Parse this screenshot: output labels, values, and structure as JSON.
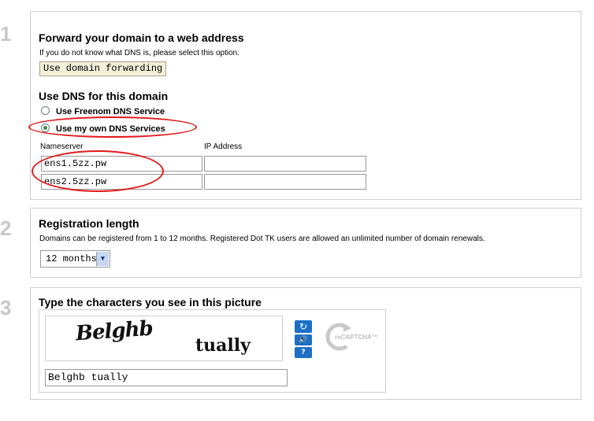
{
  "steps": {
    "one": "1",
    "two": "2",
    "three": "3"
  },
  "forwarding": {
    "title": "Forward your domain to a web address",
    "hint": "If you do not know what DNS is, please select this option.",
    "button_label": "Use domain forwarding"
  },
  "dns": {
    "title": "Use DNS for this domain",
    "options": [
      {
        "label": "Use Freenom DNS Service",
        "selected": false
      },
      {
        "label": "Use my own DNS Services",
        "selected": true
      }
    ],
    "col_nameserver": "Nameserver",
    "col_ip": "IP Address",
    "rows": [
      {
        "nameserver": "ens1.5zz.pw",
        "ip": ""
      },
      {
        "nameserver": "ens2.5zz.pw",
        "ip": ""
      }
    ]
  },
  "registration": {
    "title": "Registration length",
    "hint": "Domains can be registered from 1 to 12 months. Registered Dot TK users are allowed an unlimited number of domain renewals.",
    "selected": "12 months"
  },
  "captcha": {
    "title": "Type the characters you see in this picture",
    "word1": "Belghb",
    "word2": "tually",
    "input_value": "Belghb tually",
    "logo_text": "reCAPTCHA™",
    "refresh_glyph": "↻",
    "audio_glyph": "🔊",
    "help_glyph": "?"
  },
  "colors": {
    "annotation": "#e31a1a",
    "recaptcha_blue": "#1d6fc6"
  }
}
